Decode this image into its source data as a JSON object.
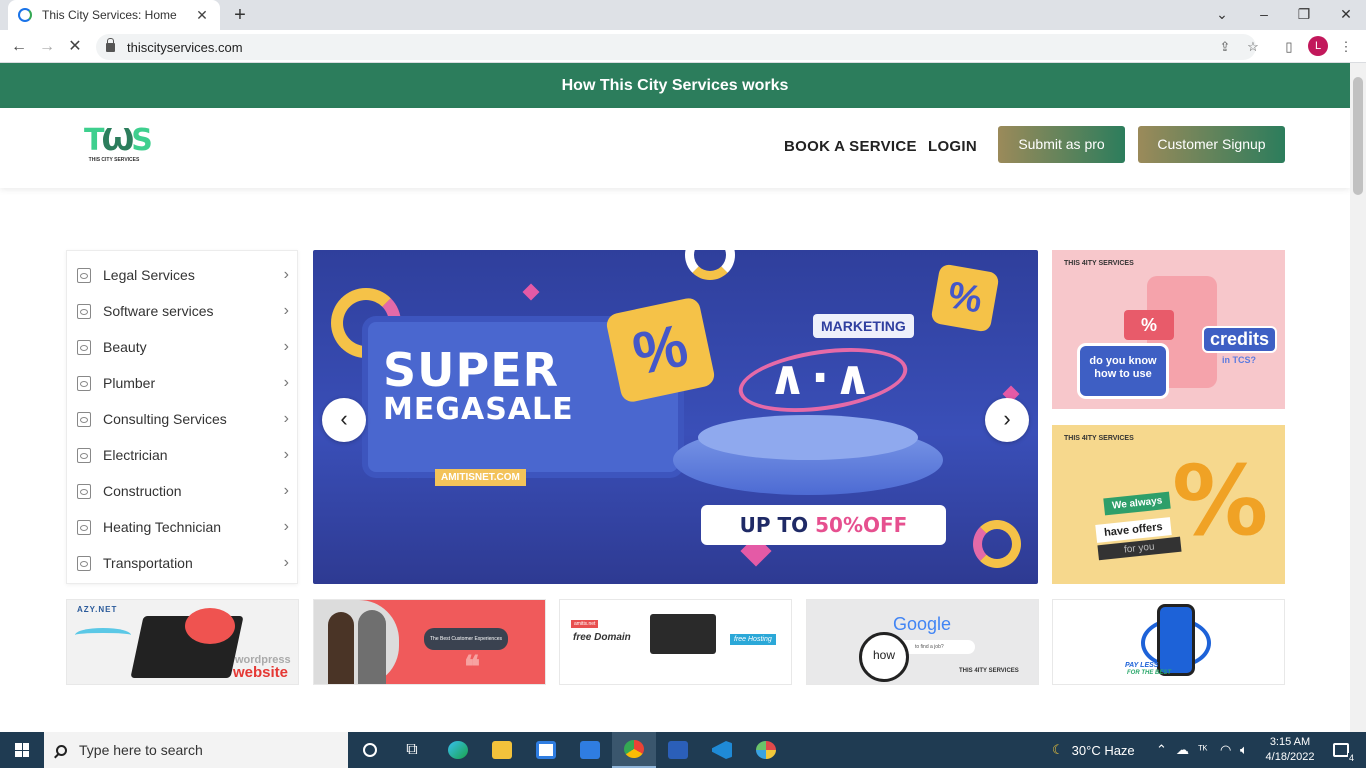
{
  "browser": {
    "tab_title": "This City Services: Home",
    "tab_close": "✕",
    "new_tab": "+",
    "url": "thiscityservices.com",
    "profile_initial": "L",
    "window_controls": [
      "⌄",
      "–",
      "❐",
      "✕"
    ],
    "nav": {
      "back": "←",
      "forward": "→",
      "reload": "✕"
    },
    "toolbar_icons": [
      "share-icon",
      "star-icon",
      "sidebar-icon",
      "menu-icon"
    ]
  },
  "banner": {
    "text": "How This City Services works"
  },
  "header": {
    "logo_mark": "T",
    "logo_mark_2": "S",
    "logo_sub": "THIS CITY SERVICES",
    "nav": [
      {
        "label": "BOOK A SERVICE"
      },
      {
        "label": "LOGIN"
      }
    ],
    "buttons": [
      {
        "label": "Submit as pro"
      },
      {
        "label": "Customer Signup"
      }
    ],
    "accent": "#2c7d5c",
    "button_gradient": [
      "#9b8a5a",
      "#2c7d5c"
    ]
  },
  "categories": [
    {
      "label": "Legal Services"
    },
    {
      "label": "Software services"
    },
    {
      "label": "Beauty"
    },
    {
      "label": "Plumber"
    },
    {
      "label": "Consulting Services"
    },
    {
      "label": "Electrician"
    },
    {
      "label": "Construction"
    },
    {
      "label": "Heating Technician"
    },
    {
      "label": "Transportation"
    }
  ],
  "slider": {
    "line1": "SUPER",
    "line2": "MEGASALE",
    "site": "AMITISNET.COM",
    "marketing": "MARKETING",
    "percent": "%",
    "logo": "∧·∧",
    "upto": "UP TO ",
    "off": "50%OFF",
    "prev": "‹",
    "next": "›"
  },
  "promos": [
    {
      "brand": "THIS 4ITY SERVICES",
      "tag": "%",
      "question": "do you know how to use",
      "credits": "credits",
      "in_tcs": "in TCS?",
      "bg": "#f7c7cb"
    },
    {
      "brand": "THIS 4ITY SERVICES",
      "big": "%",
      "we_always": "We always",
      "have_offers": "have offers",
      "for_you": "for you",
      "bg": "#f6d88d"
    }
  ],
  "thumbs": {
    "t1": {
      "brand": "AZY.NET",
      "wordpress": "wordpress",
      "website": "website"
    },
    "t2": {
      "bubble": "The Best Customer Experiences",
      "quote": "❝"
    },
    "t3": {
      "tag": "amitis.net",
      "free_domain": "free Domain",
      "free_hosting": "free Hosting"
    },
    "t4": {
      "google": "Google",
      "how": "how",
      "query": "to find a job?",
      "brand": "THIS 4ITY SERVICES"
    },
    "t5": {
      "pay_less": "PAY LESS",
      "for_best": "FOR THE BEST"
    }
  },
  "taskbar": {
    "search_placeholder": "Type here to search",
    "weather": "30°C  Haze",
    "time": "3:15 AM",
    "date": "4/18/2022",
    "notifications": "4",
    "apps": [
      "cortana-icon",
      "task-view-icon",
      "edge-icon",
      "file-explorer-icon",
      "store-icon",
      "mail-icon",
      "chrome-icon",
      "word-icon",
      "vscode-icon",
      "paint-icon"
    ]
  }
}
